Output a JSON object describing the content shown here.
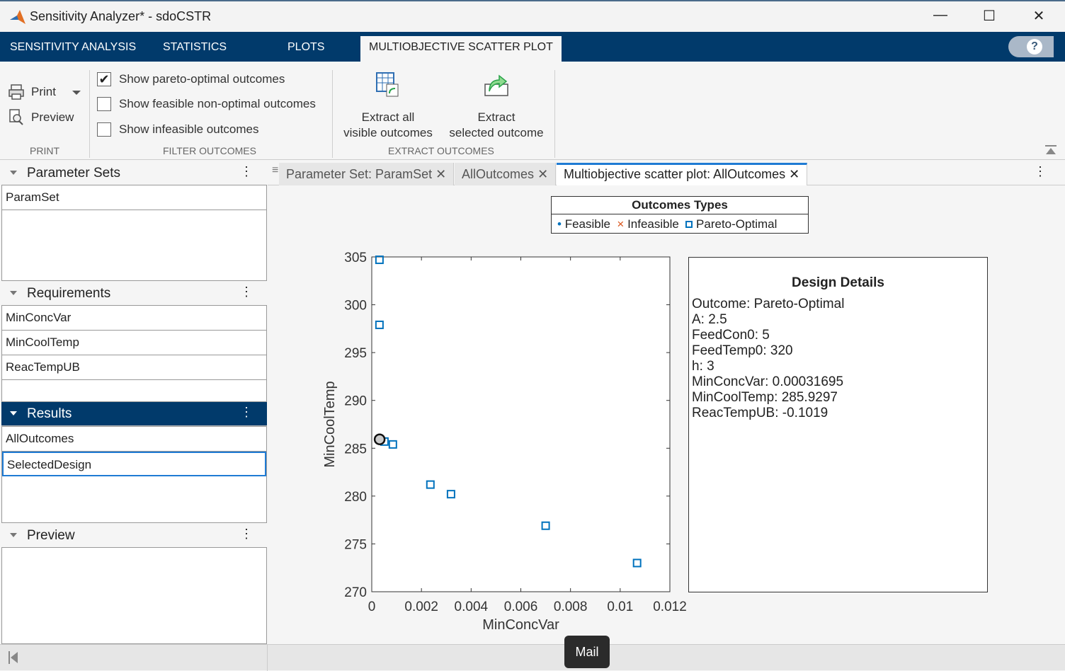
{
  "window": {
    "title": "Sensitivity Analyzer* - sdoCSTR",
    "minimize": "—",
    "maximize": "☐",
    "close": "✕"
  },
  "ribbon_tabs": [
    "SENSITIVITY ANALYSIS",
    "STATISTICS",
    "PLOTS",
    "MULTIOBJECTIVE SCATTER PLOT"
  ],
  "help": "?",
  "print_group": {
    "print": "Print",
    "preview": "Preview",
    "label": "PRINT"
  },
  "filter_group": {
    "label": "FILTER OUTCOMES",
    "options": [
      {
        "label": "Show pareto-optimal outcomes",
        "checked": true
      },
      {
        "label": "Show feasible non-optimal outcomes",
        "checked": false
      },
      {
        "label": "Show infeasible outcomes",
        "checked": false
      }
    ]
  },
  "extract_group": {
    "label": "EXTRACT OUTCOMES",
    "extract_all": [
      "Extract all",
      "visible outcomes"
    ],
    "extract_selected": [
      "Extract",
      "selected outcome"
    ]
  },
  "panels": {
    "parameter_sets": {
      "title": "Parameter Sets",
      "items": [
        "ParamSet"
      ]
    },
    "requirements": {
      "title": "Requirements",
      "items": [
        "MinConcVar",
        "MinCoolTemp",
        "ReacTempUB"
      ]
    },
    "results": {
      "title": "Results",
      "items": [
        "AllOutcomes",
        "SelectedDesign"
      ]
    },
    "preview": {
      "title": "Preview"
    }
  },
  "doc_tabs": [
    "Parameter Set: ParamSet",
    "AllOutcomes",
    "Multiobjective scatter plot: AllOutcomes"
  ],
  "legend": {
    "title": "Outcomes Types",
    "entries": [
      "Feasible",
      "Infeasible",
      "Pareto-Optimal"
    ],
    "colors": [
      "#0072bd",
      "#d95319",
      "#0072bd"
    ]
  },
  "details": {
    "title": "Design Details",
    "lines": [
      "Outcome: Pareto-Optimal",
      "A: 2.5",
      "FeedCon0: 5",
      "FeedTemp0: 320",
      "h: 3",
      "MinConcVar: 0.00031695",
      "MinCoolTemp: 285.9297",
      "ReacTempUB: -0.1019"
    ]
  },
  "taskbar_tooltip": "Mail",
  "chart_data": {
    "type": "scatter",
    "xlabel": "MinConcVar",
    "ylabel": "MinCoolTemp",
    "xlim": [
      0,
      0.012
    ],
    "ylim": [
      270,
      305
    ],
    "xticks": [
      "0",
      "0.002",
      "0.004",
      "0.006",
      "0.008",
      "0.01",
      "0.012"
    ],
    "yticks": [
      "270",
      "275",
      "280",
      "285",
      "290",
      "295",
      "300",
      "305"
    ],
    "series": [
      {
        "name": "Pareto-Optimal",
        "marker": "square",
        "color": "#0072bd",
        "x": [
          0.00031,
          0.00031,
          0.00051,
          0.00085,
          0.00236,
          0.00319,
          0.007,
          0.01068
        ],
        "y": [
          304.7,
          297.9,
          285.7,
          285.4,
          281.2,
          280.2,
          276.9,
          273.0
        ]
      }
    ],
    "selected": {
      "x": 0.00031695,
      "y": 285.9297
    }
  }
}
